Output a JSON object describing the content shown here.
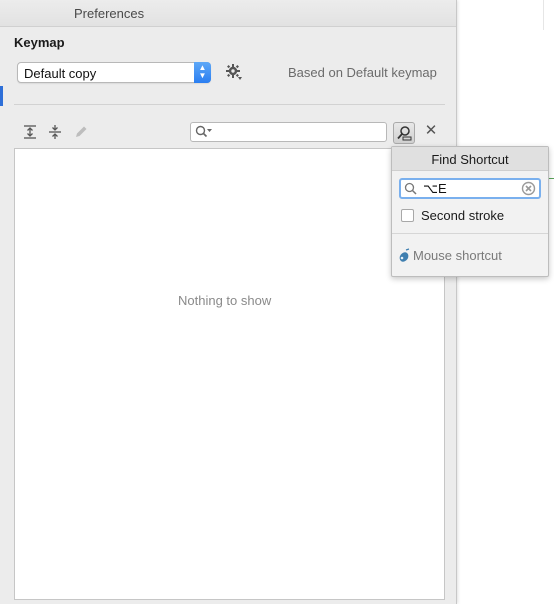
{
  "window": {
    "title": "Preferences"
  },
  "keymap": {
    "section_title": "Keymap",
    "selected": "Default copy",
    "based_on": "Based on Default keymap"
  },
  "toolbar": {
    "icons": [
      "expand-all-icon",
      "collapse-all-icon",
      "edit-icon"
    ],
    "search_placeholder": ""
  },
  "list": {
    "empty_text": "Nothing to show"
  },
  "find_shortcut_popup": {
    "title": "Find Shortcut",
    "shortcut_value": "⌥E",
    "second_stroke_label": "Second stroke",
    "second_stroke_checked": false,
    "mouse_shortcut_label": "Mouse shortcut"
  },
  "colors": {
    "accent": "#2a7ef1",
    "focus_ring": "#7ab0ee"
  }
}
